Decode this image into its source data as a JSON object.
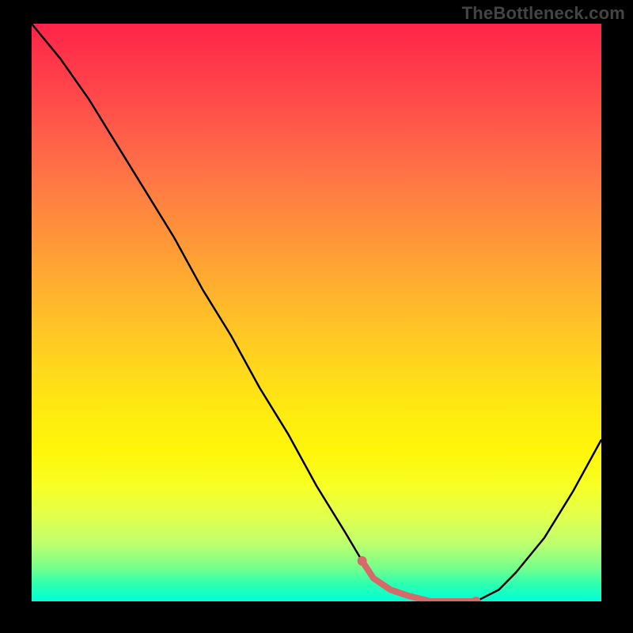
{
  "watermark": "TheBottleneck.com",
  "chart_data": {
    "type": "line",
    "title": "",
    "xlabel": "",
    "ylabel": "",
    "xlim": [
      0,
      100
    ],
    "ylim": [
      0,
      100
    ],
    "series": [
      {
        "name": "curve",
        "x": [
          0,
          5,
          10,
          15,
          20,
          25,
          30,
          35,
          40,
          45,
          50,
          55,
          58,
          60,
          63,
          66,
          70,
          74,
          78,
          82,
          85,
          90,
          95,
          100
        ],
        "values": [
          100,
          94,
          87,
          79,
          71,
          63,
          54,
          46,
          37,
          29,
          20,
          12,
          7,
          4,
          2,
          1,
          0,
          0,
          0,
          2,
          5,
          11,
          19,
          28
        ]
      },
      {
        "name": "highlight",
        "x": [
          58,
          60,
          63,
          66,
          70,
          74,
          78
        ],
        "values": [
          7,
          4,
          2,
          1,
          0,
          0,
          0
        ]
      }
    ],
    "highlight_color": "#d46a6a",
    "curve_color": "#000000"
  }
}
